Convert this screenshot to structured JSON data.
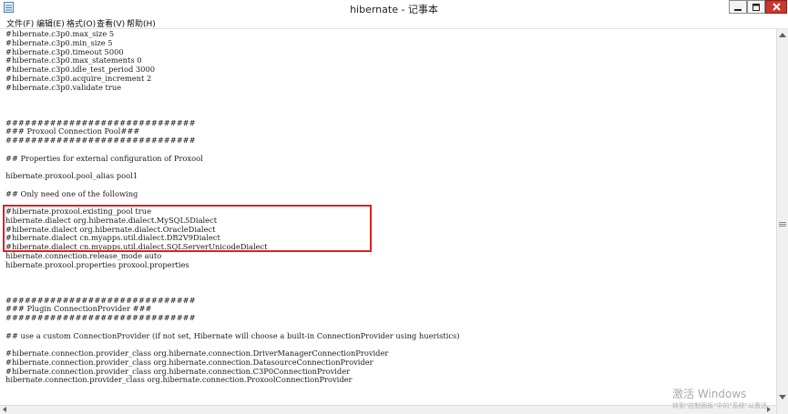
{
  "window": {
    "title": "hibernate - 记事本",
    "icon": "notepad-icon",
    "controls": [
      "minimize-icon",
      "maximize-icon",
      "close-icon"
    ]
  },
  "menu": {
    "items": [
      {
        "label": "文件(F)"
      },
      {
        "label": "编辑(E)"
      },
      {
        "label": "格式(O)"
      },
      {
        "label": "查看(V)"
      },
      {
        "label": "帮助(H)"
      }
    ]
  },
  "editor": {
    "highlight_color": "#e02020",
    "lines": [
      "#hibernate.c3p0.max_size 5",
      "#hibernate.c3p0.min_size 5",
      "#hibernate.c3p0.timeout 5000",
      "#hibernate.c3p0.max_statements 0",
      "#hibernate.c3p0.idle_test_period 3000",
      "#hibernate.c3p0.acquire_increment 2",
      "#hibernate.c3p0.validate true",
      "",
      "",
      "",
      "##############################",
      "### Proxool Connection Pool###",
      "##############################",
      "",
      "## Properties for external configuration of Proxool",
      "",
      "hibernate.proxool.pool_alias pool1",
      "",
      "## Only need one of the following",
      "",
      "#hibernate.proxool.existing_pool true",
      "hibernate.dialect org.hibernate.dialect.MySQL5Dialect",
      "#hibernate.dialect org.hibernate.dialect.OracleDialect",
      "#hibernate.dialect cn.myapps.util.dialect.DB2V9Dialect",
      "#hibernate.dialect cn.myapps.util.dialect.SQLServerUnicodeDialect",
      "hibernate.connection.release_mode auto",
      "hibernate.proxool.properties proxool.properties",
      "",
      "",
      "",
      "##############################",
      "### Plugin ConnectionProvider ###",
      "##############################",
      "",
      "## use a custom ConnectionProvider (if not set, Hibernate will choose a built-in ConnectionProvider using hueristics)",
      "",
      "#hibernate.connection.provider_class org.hibernate.connection.DriverManagerConnectionProvider",
      "#hibernate.connection.provider_class org.hibernate.connection.DatasourceConnectionProvider",
      "#hibernate.connection.provider_class org.hibernate.connection.C3P0ConnectionProvider",
      "hibernate.connection.provider_class org.hibernate.connection.ProxoolConnectionProvider"
    ]
  },
  "watermark": {
    "title": "激活 Windows",
    "subtitle": "转到\"控制面板\"中的\"系统\"以激活"
  }
}
